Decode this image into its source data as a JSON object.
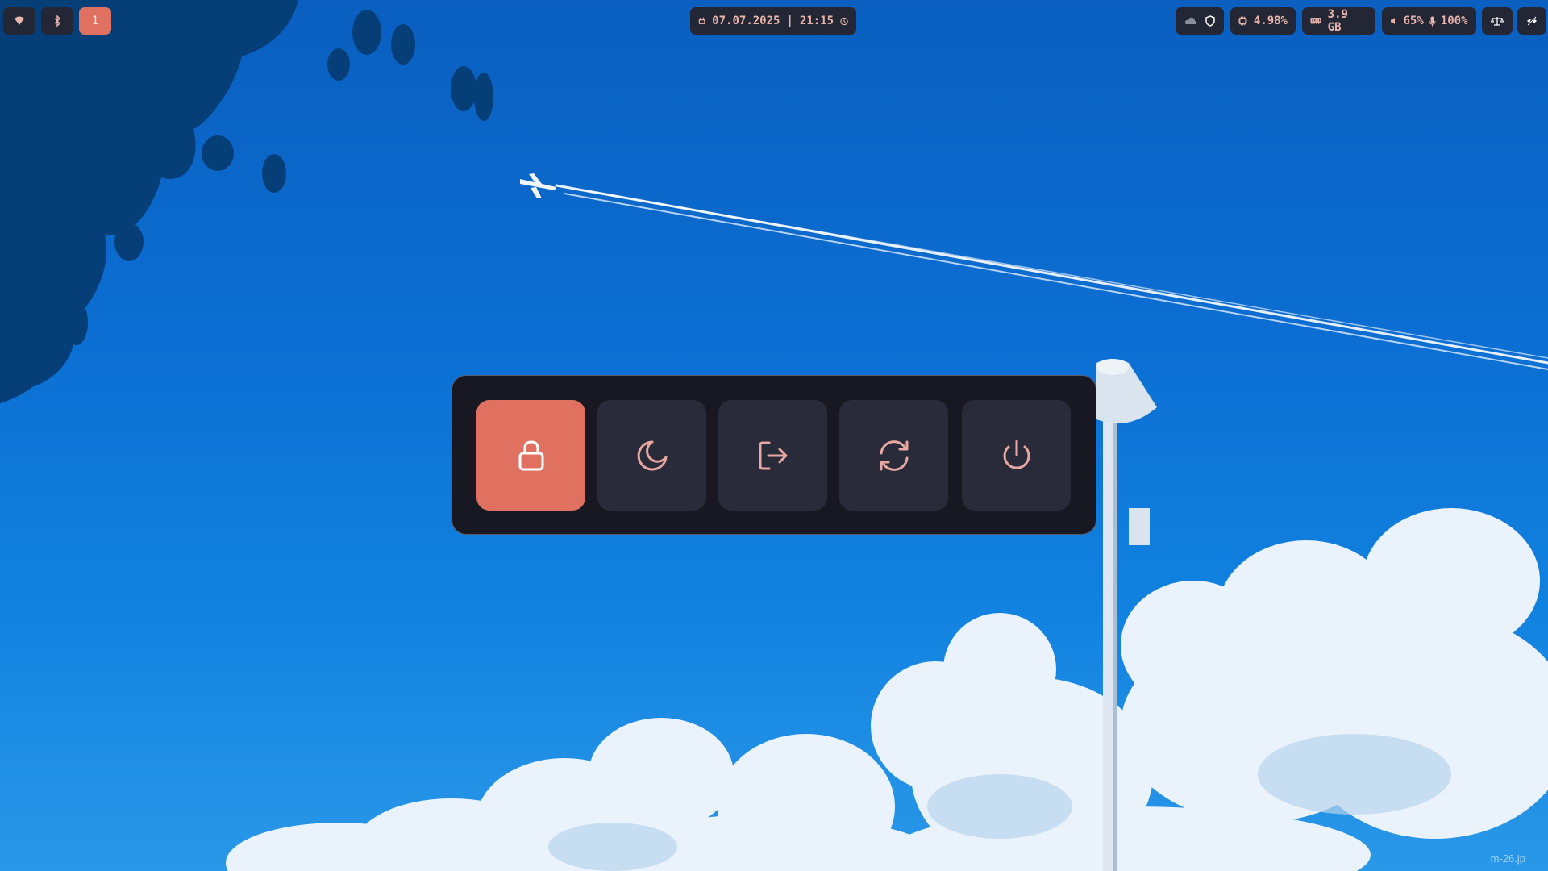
{
  "topbar": {
    "left": {
      "icons": [
        "wifi-icon",
        "bluetooth-icon"
      ],
      "workspaces": [
        "1"
      ],
      "active_workspace": "1"
    },
    "center": {
      "date": "07.07.2025",
      "separator": "|",
      "time": "21:15",
      "icons": [
        "calendar-icon",
        "clock-icon"
      ]
    },
    "right": {
      "cpu": "4.98%",
      "memory": "3.9 GB",
      "volume": "65%",
      "microphone": "100%",
      "icons": [
        "cloud-icon",
        "shield-icon",
        "cpu-icon",
        "memory-icon",
        "speaker-icon",
        "microphone-icon",
        "scale-icon",
        "eye-off-icon"
      ]
    }
  },
  "power_menu": {
    "buttons": [
      {
        "name": "lock",
        "icon": "lock-icon",
        "active": true
      },
      {
        "name": "suspend",
        "icon": "moon-icon",
        "active": false
      },
      {
        "name": "logout",
        "icon": "logout-icon",
        "active": false
      },
      {
        "name": "reboot",
        "icon": "refresh-icon",
        "active": false
      },
      {
        "name": "shutdown",
        "icon": "power-icon",
        "active": false
      }
    ]
  },
  "wallpaper": {
    "signature": "m-26.jp"
  },
  "colors": {
    "accent": "#e07060",
    "panel": "#171821",
    "button": "#292b3a",
    "icon": "#e8a8a0"
  }
}
